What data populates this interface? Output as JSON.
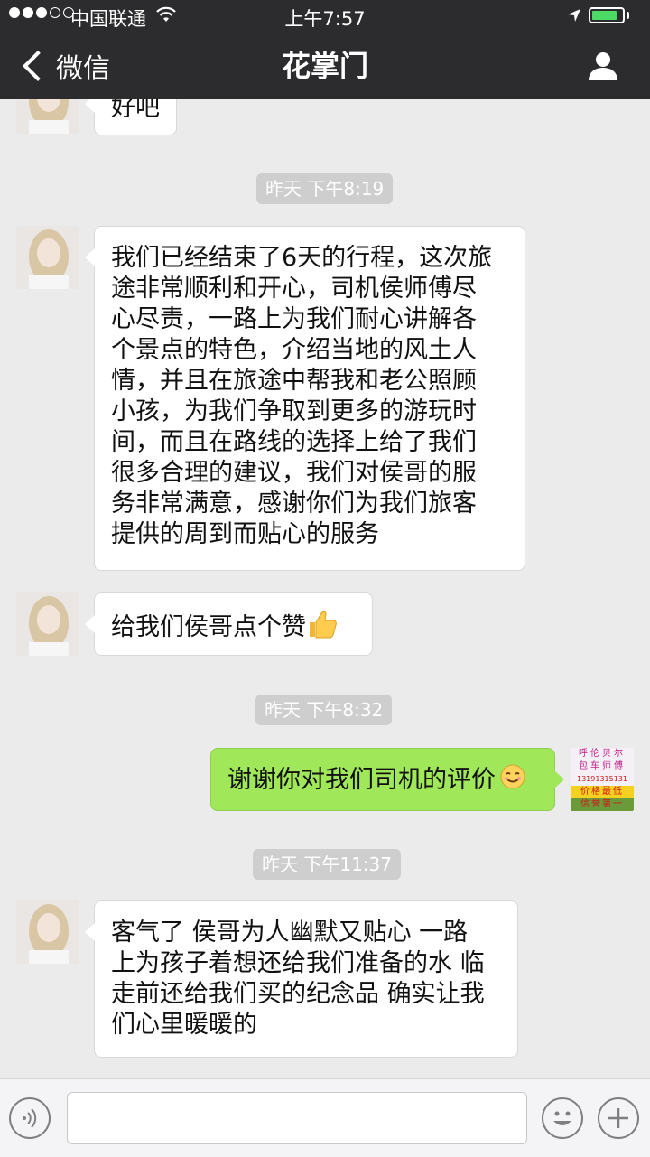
{
  "status_bar": {
    "carrier": "中国联通",
    "time": "上午7:57",
    "battery_level": 0.85,
    "battery_color": "#4cd964"
  },
  "nav": {
    "back_label": "微信",
    "title": "花掌门",
    "profile_icon": "person-icon"
  },
  "messages": [
    {
      "side": "left",
      "text": "好吧"
    },
    {
      "type": "timestamp",
      "text": "昨天 下午8:19"
    },
    {
      "side": "left",
      "lines": [
        "我们已经结束了6天的行程，这次旅",
        "途非常顺利和开心，司机侯师傅尽",
        "心尽责，一路上为我们耐心讲解各",
        "个景点的特色，介绍当地的风土人",
        "情，并且在旅途中帮我和老公照顾",
        "小孩，为我们争取到更多的游玩时",
        "间，而且在路线的选择上给了我们",
        "很多合理的建议，我们对侯哥的服",
        "务非常满意，感谢你们为我们旅客",
        "提供的周到而贴心的服务"
      ]
    },
    {
      "side": "left",
      "text": "给我们侯哥点个赞",
      "emoji": "thumbs-up-icon"
    },
    {
      "type": "timestamp",
      "text": "昨天 下午8:32"
    },
    {
      "side": "right",
      "text": "谢谢你对我们司机的评价",
      "emoji": "smile-icon"
    },
    {
      "type": "timestamp",
      "text": "昨天 下午11:37"
    },
    {
      "side": "left",
      "lines": [
        "客气了 侯哥为人幽默又贴心 一路",
        "上为孩子着想还给我们准备的水 临",
        "走前还给我们买的纪念品 确实让我",
        "们心里暖暖的"
      ]
    }
  ],
  "self_avatar": {
    "lines": [
      "呼伦贝尔",
      "包车师傅",
      "13191315131",
      "价格最低",
      "信誉第一"
    ]
  },
  "input_bar": {
    "voice_icon": "voice-icon",
    "emoji_icon": "emoji-icon",
    "add_icon": "plus-icon"
  },
  "colors": {
    "nav_bg": "#2c2c2e",
    "chat_bg": "#ebebeb",
    "self_bubble": "#a0e75a"
  }
}
